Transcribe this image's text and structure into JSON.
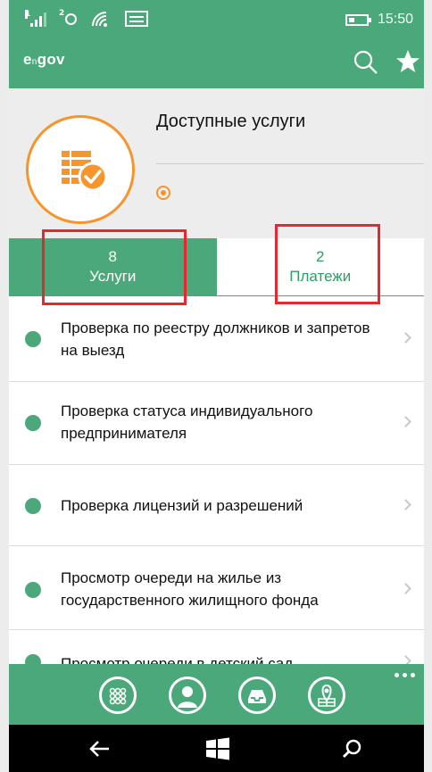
{
  "status_bar": {
    "signal_1": "1",
    "signal_2": "2",
    "time": "15:50"
  },
  "app_bar": {
    "logo_e": "e",
    "logo_small": "n",
    "logo_rest": "gov",
    "icons": [
      "search-icon",
      "star-icon"
    ]
  },
  "header": {
    "title": "Доступные услуги",
    "icon": "services-checked-icon",
    "accent_color": "#f5952b"
  },
  "tabs": [
    {
      "count": "8",
      "label": "Услуги",
      "active": true
    },
    {
      "count": "2",
      "label": "Платежи",
      "active": false
    }
  ],
  "services": [
    "Проверка по реестру должников и запретов на выезд",
    "Проверка статуса индивидуального предпринимателя",
    "Проверка лицензий и разрешений",
    "Просмотр очереди на жилье из государственного жилищного фонда",
    "Просмотр очереди в детский сад"
  ],
  "bottom_bar": {
    "icons": [
      "apps-grid-icon",
      "profile-icon",
      "inbox-icon",
      "map-icon",
      "more-icon"
    ]
  },
  "nav_bar": {
    "icons": [
      "back-icon",
      "windows-icon",
      "search-icon"
    ]
  },
  "colors": {
    "primary": "#4aa87a",
    "accent": "#f5952b",
    "highlight": "#e8262d"
  }
}
